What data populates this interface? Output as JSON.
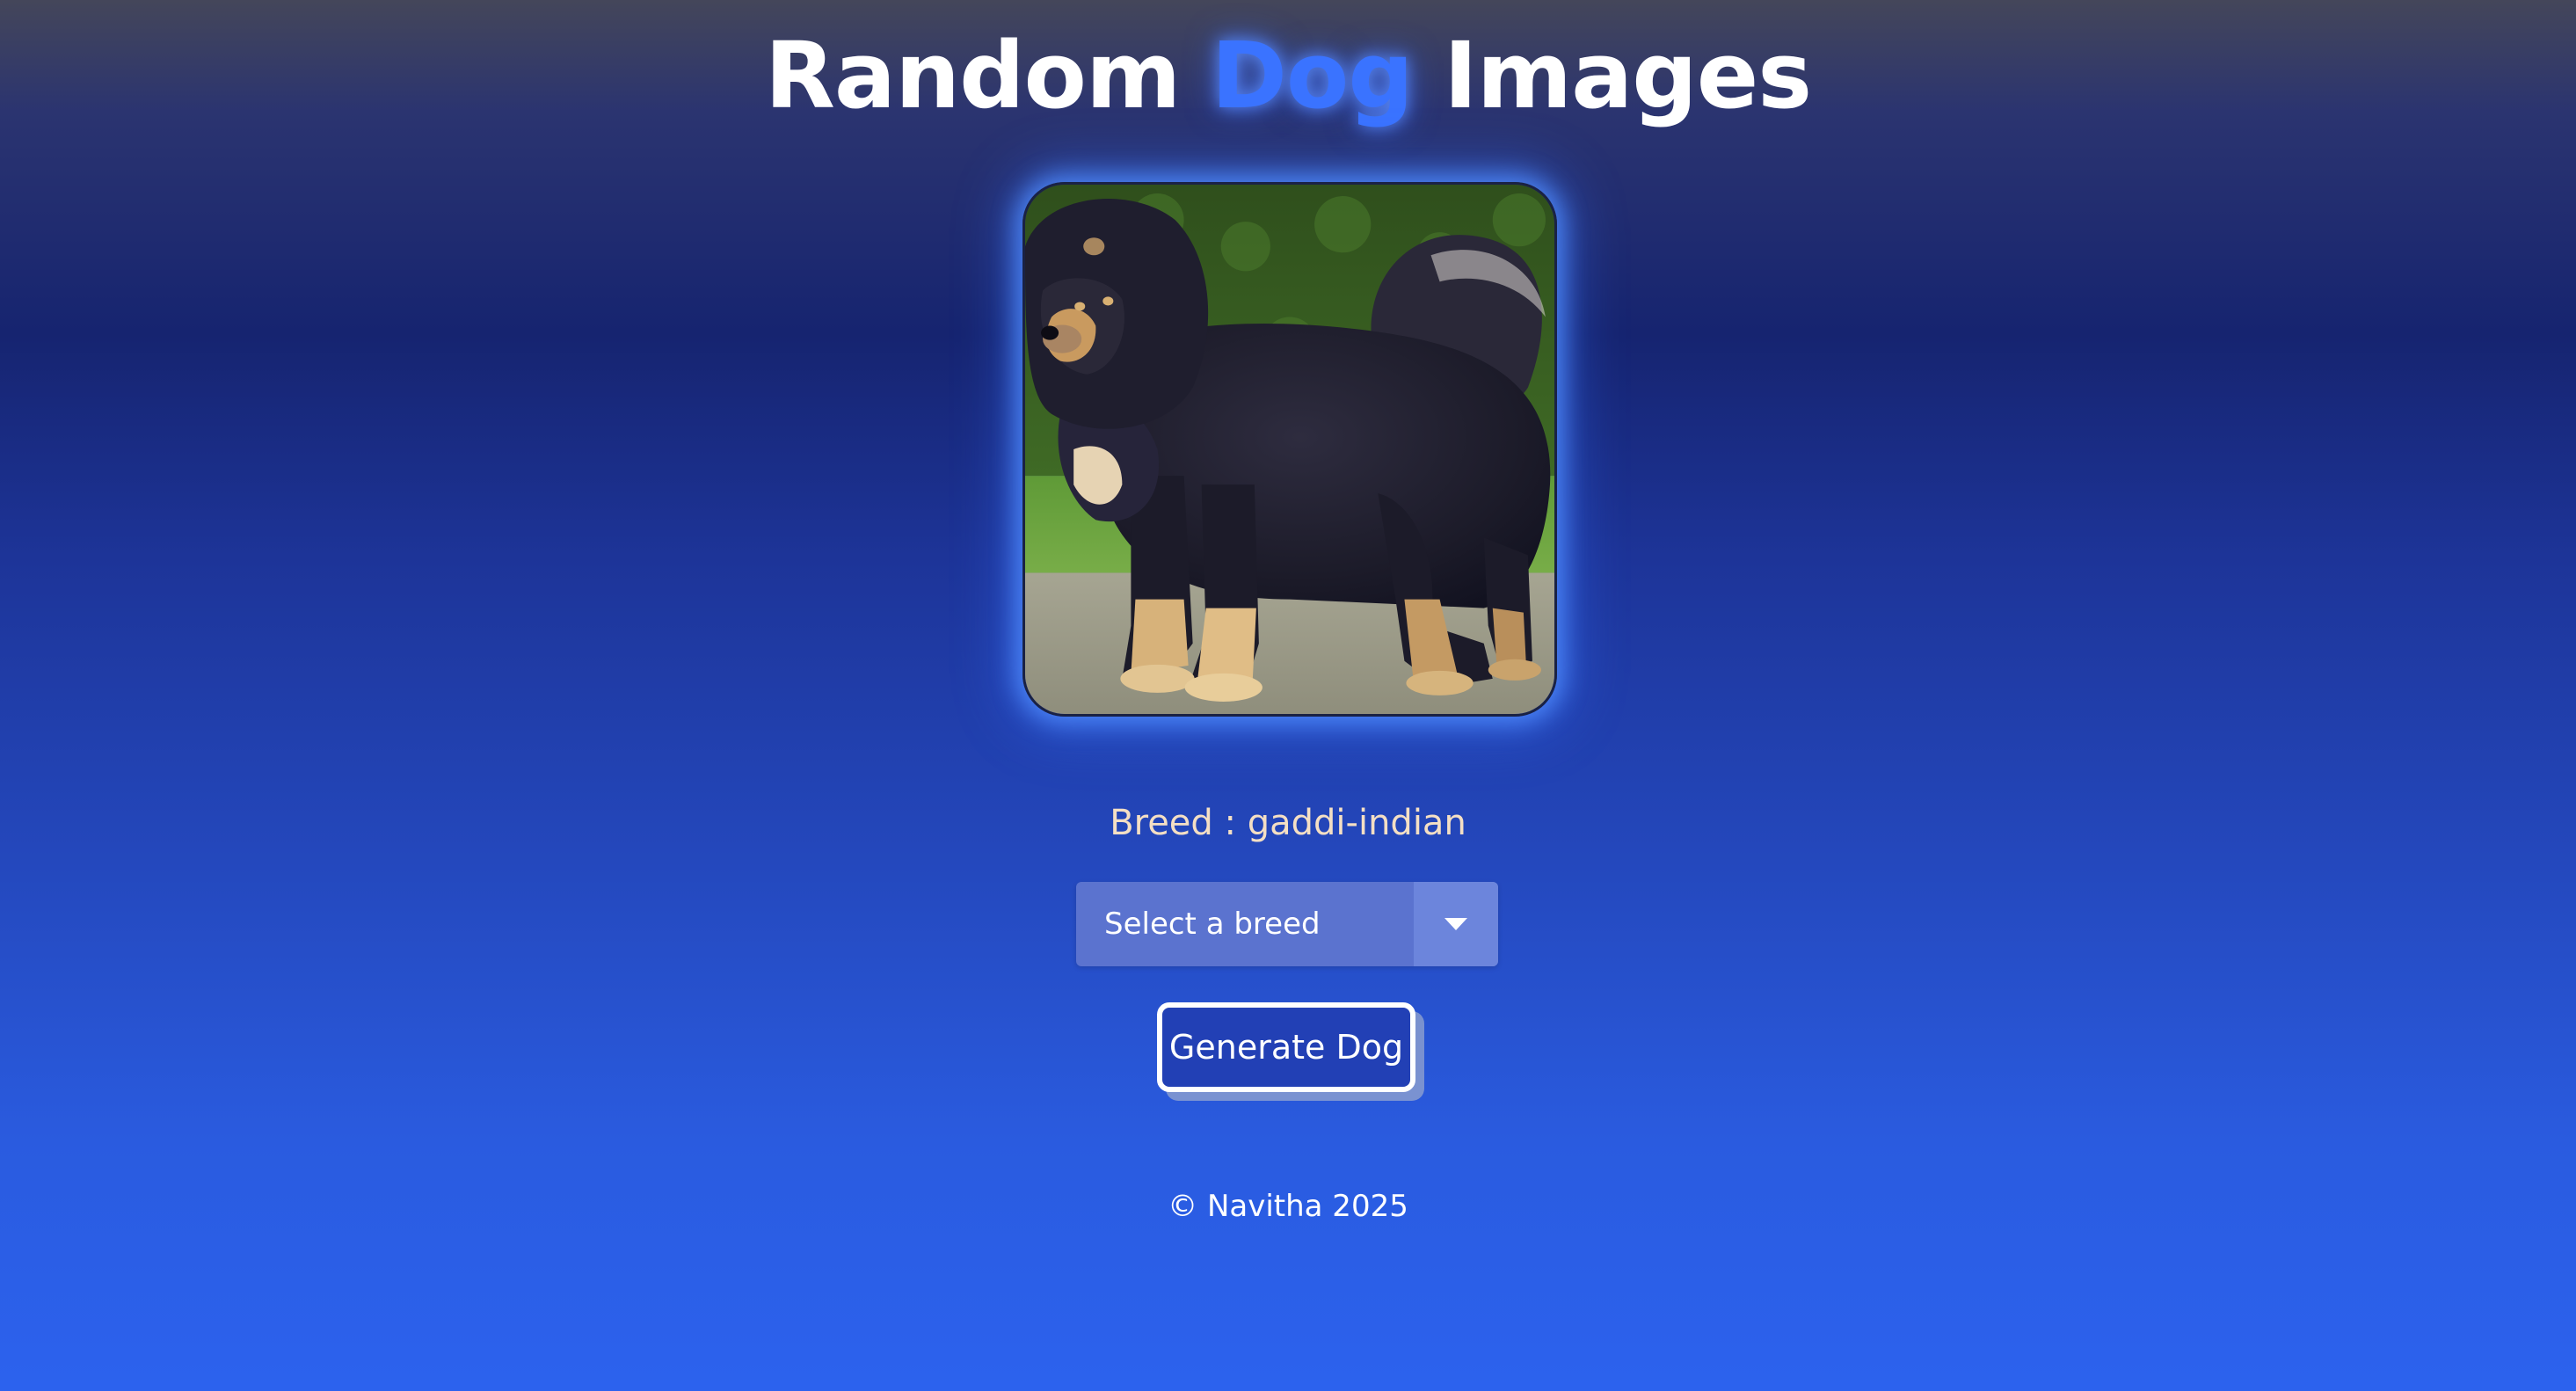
{
  "header": {
    "title_word_1": "Random",
    "title_word_2": "Dog",
    "title_word_3": "Images"
  },
  "dog_image": {
    "alt": "Dog image"
  },
  "breed": {
    "label": "Breed",
    "separator": ":",
    "value": "gaddi-indian"
  },
  "breed_select": {
    "selected": "Select a breed",
    "icon": "caret-down-icon"
  },
  "generate_button": {
    "label": "Generate Dog"
  },
  "footer": {
    "symbol": "©",
    "text": "Navitha 2025"
  },
  "colors": {
    "accent": "#3a73ff",
    "breed_text": "#f4dfc4",
    "select_bg": "#5b73cf",
    "button_bg": "#2240b5"
  }
}
